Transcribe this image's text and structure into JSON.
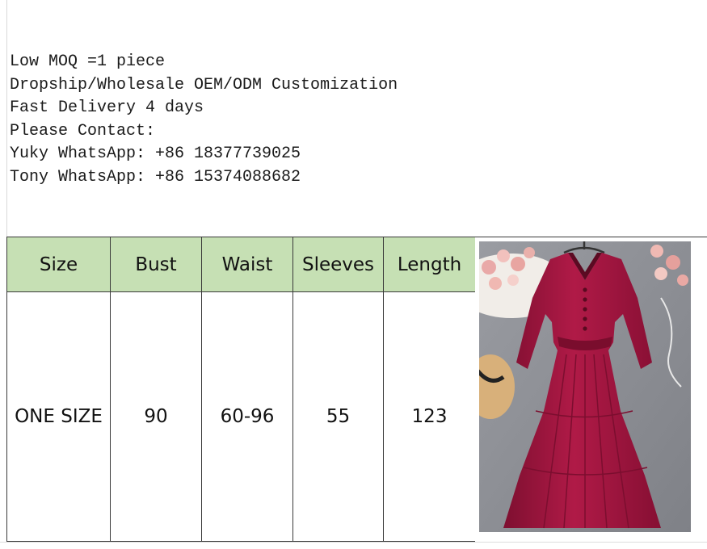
{
  "info_lines": [
    "Low MOQ =1 piece",
    "Dropship/Wholesale OEM/ODM Customization",
    "Fast Delivery 4 days",
    "Please Contact:",
    "Yuky WhatsApp: +86 18377739025",
    "Tony WhatsApp: +86 15374088682"
  ],
  "size_table": {
    "headers": [
      "Size",
      "Bust",
      "Waist",
      "Sleeves",
      "Length"
    ],
    "row": [
      "ONE SIZE",
      "90",
      "60-96",
      "55",
      "123"
    ]
  },
  "colors": {
    "header_bg": "#c6e0b4",
    "dress": "#a0163f",
    "floor": "#8e9096"
  },
  "image": {
    "subject": "dress-photo"
  }
}
